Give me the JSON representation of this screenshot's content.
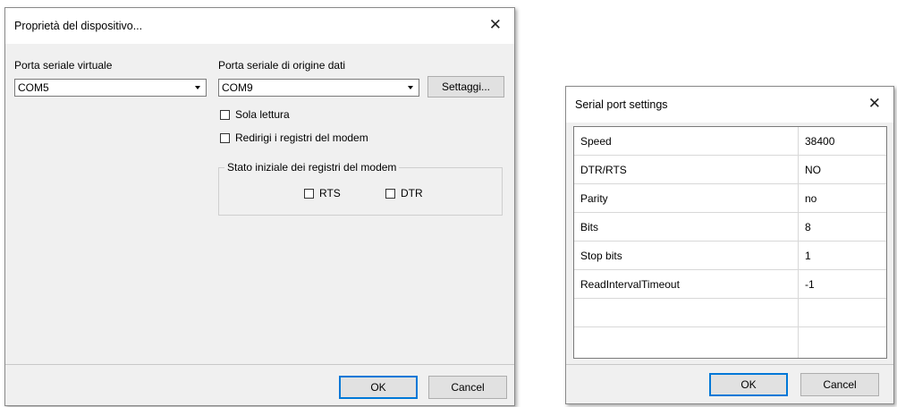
{
  "device_dialog": {
    "title": "Proprietà del dispositivo...",
    "close_glyph": "✕",
    "virtual_port_label": "Porta seriale virtuale",
    "virtual_port_value": "COM5",
    "source_port_label": "Porta seriale di origine dati",
    "source_port_value": "COM9",
    "settings_button": "Settaggi...",
    "read_only_label": "Sola lettura",
    "redirect_modem_label": "Redirigi i registri del modem",
    "initial_state_group": "Stato iniziale dei registri del modem",
    "rts_label": "RTS",
    "dtr_label": "DTR",
    "ok_button": "OK",
    "cancel_button": "Cancel"
  },
  "serial_dialog": {
    "title": "Serial port settings",
    "close_glyph": "✕",
    "rows": [
      {
        "name": "Speed",
        "value": "38400"
      },
      {
        "name": "DTR/RTS",
        "value": "NO"
      },
      {
        "name": "Parity",
        "value": "no"
      },
      {
        "name": "Bits",
        "value": "8"
      },
      {
        "name": "Stop bits",
        "value": "1"
      },
      {
        "name": "ReadIntervalTimeout",
        "value": "-1"
      }
    ],
    "ok_button": "OK",
    "cancel_button": "Cancel"
  }
}
